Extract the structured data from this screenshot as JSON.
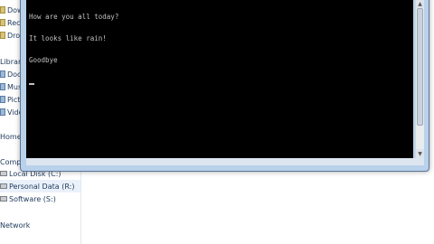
{
  "explorer": {
    "favorites": [
      "Dow",
      "Rece",
      "Drop"
    ],
    "libraries_header": "Librar",
    "libraries": [
      "Docu",
      "Mus",
      "Pictu",
      "Vide"
    ],
    "homegroup": "Home",
    "computer_header": "Comp",
    "drives": [
      "Local Disk (C:)",
      "Personal Data (R:)",
      "Software (S:)"
    ],
    "network": "Network"
  },
  "console": {
    "lines": [
      "How are you all today?",
      "It looks like rain!",
      "Goodbye"
    ]
  }
}
